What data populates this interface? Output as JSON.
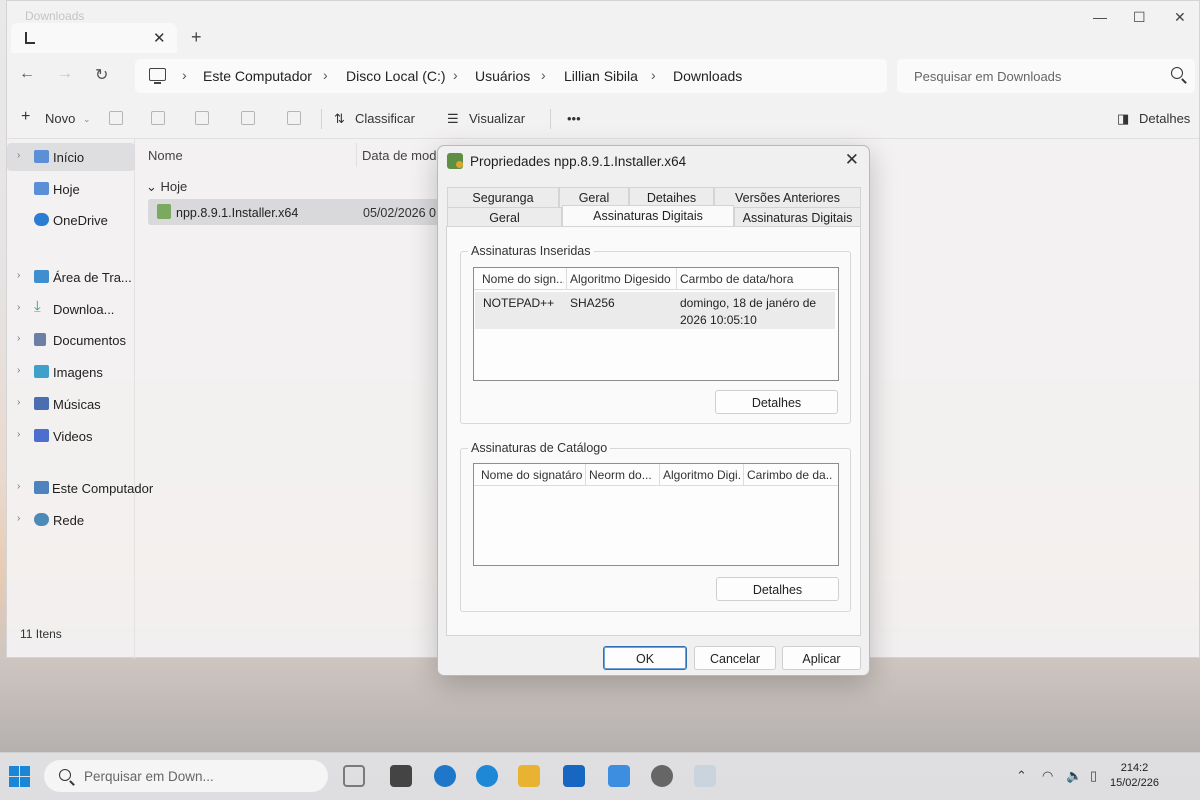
{
  "explorer": {
    "ghost_title": "Downloads",
    "tab_close": "✕",
    "new_tab": "+",
    "window_controls": {
      "minimize": "—",
      "maximize": "☐",
      "close": "✕"
    },
    "nav": {
      "back": "←",
      "forward": "→",
      "refresh": "↻"
    },
    "breadcrumb": [
      "Este Computador",
      "Disco Local (C:)",
      "Usuários",
      "Lillian Sibila",
      "Downloads"
    ],
    "breadcrumb_sep": "›",
    "search_placeholder": "Pesquisar em Downloads",
    "toolbar": {
      "new_label": "Novo",
      "sort_label": "Classificar",
      "view_label": "Visualizar",
      "more_label": "•••",
      "details_label": "Detalhes"
    },
    "sidebar": {
      "items": [
        {
          "label": "Início",
          "icon": "home-icon",
          "color": "#5b8fd6"
        },
        {
          "label": "Hoje",
          "icon": "folder-icon",
          "color": "#5b8fd6"
        },
        {
          "label": "OneDrive",
          "icon": "cloud-icon",
          "color": "#2b7cd3"
        },
        {
          "label": "Área de Tra...",
          "icon": "desktop-icon",
          "color": "#3f8fd0"
        },
        {
          "label": "Downloa...",
          "icon": "download-icon",
          "color": "#3aa36b"
        },
        {
          "label": "Documentos",
          "icon": "document-icon",
          "color": "#6c7fa6"
        },
        {
          "label": "Imagens",
          "icon": "image-icon",
          "color": "#3fa1c9"
        },
        {
          "label": "Músicas",
          "icon": "music-icon",
          "color": "#4a6fb0"
        },
        {
          "label": "Videos",
          "icon": "video-icon",
          "color": "#4c6ecf"
        },
        {
          "label": "Este Computador",
          "icon": "computer-icon",
          "color": "#4f83bd"
        },
        {
          "label": "Rede",
          "icon": "network-icon",
          "color": "#4d8ab8"
        }
      ]
    },
    "status_text": "11 Itens",
    "columns": {
      "name": "Nome",
      "date": "Data de mod"
    },
    "group_label": "Hoje",
    "file": {
      "name": "npp.8.9.1.Installer.x64",
      "date": "05/02/2026 0"
    }
  },
  "dialog": {
    "title": "Propriedades npp.8.9.1.Installer.x64",
    "close": "✕",
    "tabs_row1": [
      "Seguranga",
      "Geral",
      "Detaihes",
      "Versões Anteriores"
    ],
    "tabs_row2": [
      "Geral",
      "Assinaturas Digitais",
      "Assinaturas Digitais"
    ],
    "embedded": {
      "label": "Assinaturas Inseridas",
      "headers": [
        "Nome do sign...",
        "Algoritmo Digesido",
        "Carmbo de data/hora"
      ],
      "row": {
        "name": "NOTEPAD++",
        "algorithm": "SHA256",
        "timestamp_line1": "domingo, 18 de janéro de",
        "timestamp_line2": "2026 10:05:10"
      },
      "details_button": "Detalhes"
    },
    "catalog": {
      "label": "Assinaturas de Catálogo",
      "headers": [
        "Nome do signatáro",
        "Neorm do...",
        "Algoritmo Digi...",
        "Carimbo de da..."
      ],
      "details_button": "Detalhes"
    },
    "buttons": {
      "ok": "OK",
      "cancel": "Cancelar",
      "apply": "Aplicar"
    }
  },
  "taskbar": {
    "search_placeholder": "Perquisar em Down...",
    "apps": [
      {
        "icon": "task-view-icon",
        "color": "#7a7a7a"
      },
      {
        "icon": "widgets-icon",
        "color": "#444444"
      },
      {
        "icon": "globe-icon",
        "color": "#1f77c9"
      },
      {
        "icon": "edge-icon",
        "color": "#1e88d6"
      },
      {
        "icon": "file-explorer-icon",
        "color": "#e8b331"
      },
      {
        "icon": "store-icon",
        "color": "#1767c2"
      },
      {
        "icon": "chat-icon",
        "color": "#3d8ee0"
      },
      {
        "icon": "settings-icon",
        "color": "#666666"
      },
      {
        "icon": "blank-app-icon",
        "color": "#c9d4df"
      }
    ],
    "tray": {
      "chevron": "⌃",
      "wifi": "◠",
      "volume": "🔈",
      "battery": "▯"
    },
    "time": "214:2",
    "date": "15/02/226"
  }
}
